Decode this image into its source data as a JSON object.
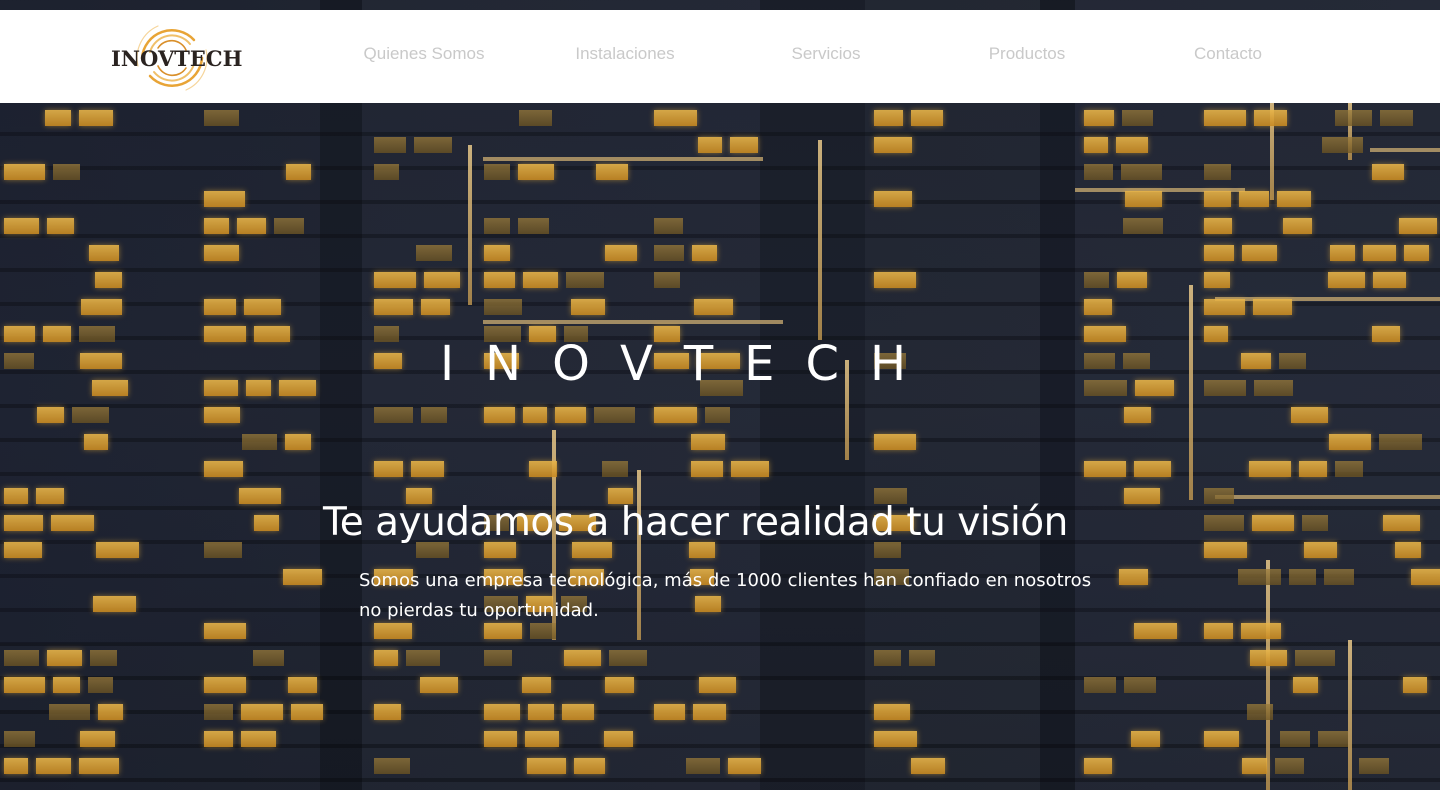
{
  "logo": {
    "text": "INOVTECH",
    "icon": "spiral-logo-icon"
  },
  "nav": {
    "items": [
      {
        "label": "Quienes Somos"
      },
      {
        "label": "Instalaciones"
      },
      {
        "label": "Servicios"
      },
      {
        "label": "Productos"
      },
      {
        "label": "Contacto"
      }
    ]
  },
  "hero": {
    "brand_title": "INOVTECH",
    "headline": "Te ayudamos a hacer realidad tu visión",
    "subtext": "Somos una empresa tecnológica, más de 1000 clientes han confiado en nosotros no pierdas tu oportunidad."
  },
  "colors": {
    "nav_background": "#ffffff",
    "nav_text": "#c9c9c9",
    "hero_text": "#ffffff",
    "window_light": "#e8b54a"
  }
}
